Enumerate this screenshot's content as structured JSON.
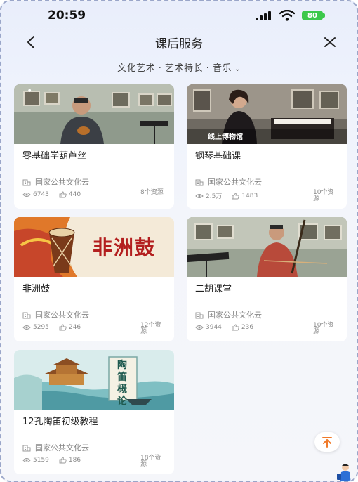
{
  "status_bar": {
    "time": "20:59",
    "battery": "80"
  },
  "header": {
    "title": "课后服务"
  },
  "breadcrumb": {
    "text": "文化艺术 · 艺术特长 · 音乐"
  },
  "cards": [
    {
      "title": "零基础学葫芦丝",
      "source": "国家公共文化云",
      "views": "6743",
      "likes": "440",
      "resources": "8个资源",
      "thumb_overlay": ""
    },
    {
      "title": "钢琴基础课",
      "source": "国家公共文化云",
      "views": "2.5万",
      "likes": "1483",
      "resources": "10个资源",
      "thumb_overlay": "线上博物馆"
    },
    {
      "title": "非洲鼓",
      "source": "国家公共文化云",
      "views": "5295",
      "likes": "246",
      "resources": "12个资源",
      "thumb_overlay": "非洲鼓"
    },
    {
      "title": "二胡课堂",
      "source": "国家公共文化云",
      "views": "3944",
      "likes": "236",
      "resources": "10个资源",
      "thumb_overlay": ""
    },
    {
      "title": "12孔陶笛初级教程",
      "source": "国家公共文化云",
      "views": "5159",
      "likes": "186",
      "resources": "18个资源",
      "thumb_overlay": "陶笛概论"
    }
  ],
  "icons": {
    "back": "chevron-left-icon",
    "close": "close-icon",
    "source": "building-icon",
    "views": "eye-icon",
    "likes": "thumbs-up-icon",
    "scroll_top": "arrow-up-to-top-icon"
  },
  "colors": {
    "accent_orange": "#f07a2a",
    "battery_green": "#3cc84b",
    "background": "#eef2fc"
  }
}
